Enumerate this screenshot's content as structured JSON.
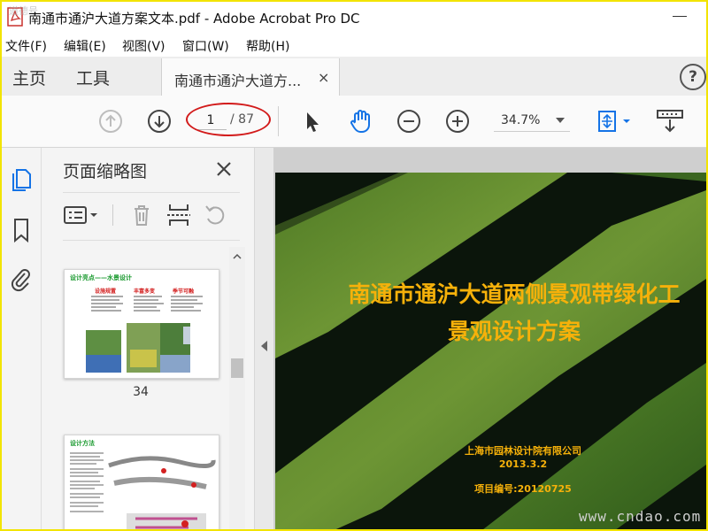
{
  "window": {
    "title": "南通市通沪大道方案文本.pdf - Adobe Acrobat Pro DC",
    "watermark_corner": "道德号"
  },
  "menu": [
    "文件(F)",
    "编辑(E)",
    "视图(V)",
    "窗口(W)",
    "帮助(H)"
  ],
  "tabs": {
    "home": "主页",
    "tools": "工具",
    "document": "南通市通沪大道方...",
    "close": "×",
    "help": "?"
  },
  "toolbar": {
    "current_page": "1",
    "total_pages": "/ 87",
    "zoom": "34.7%"
  },
  "panel": {
    "title": "页面缩略图",
    "thumbnails": [
      {
        "label": "34",
        "heading": "设计亮点——水景设计",
        "columns": [
          "设施规置",
          "丰富多变",
          "季节可融"
        ]
      },
      {
        "label": "",
        "heading": "设计方法"
      }
    ]
  },
  "document": {
    "title_line1": "南通市通沪大道两侧景观带绿化工",
    "title_line2": "景观设计方案",
    "organization": "上海市园林设计院有限公司",
    "date": "2013.3.2",
    "project_no": "项目编号:20120725"
  },
  "watermark": "www.cndao.com",
  "colors": {
    "accent_blue": "#1473e6",
    "title_yellow": "#f6b10a",
    "highlight_red": "#d21a1a"
  }
}
